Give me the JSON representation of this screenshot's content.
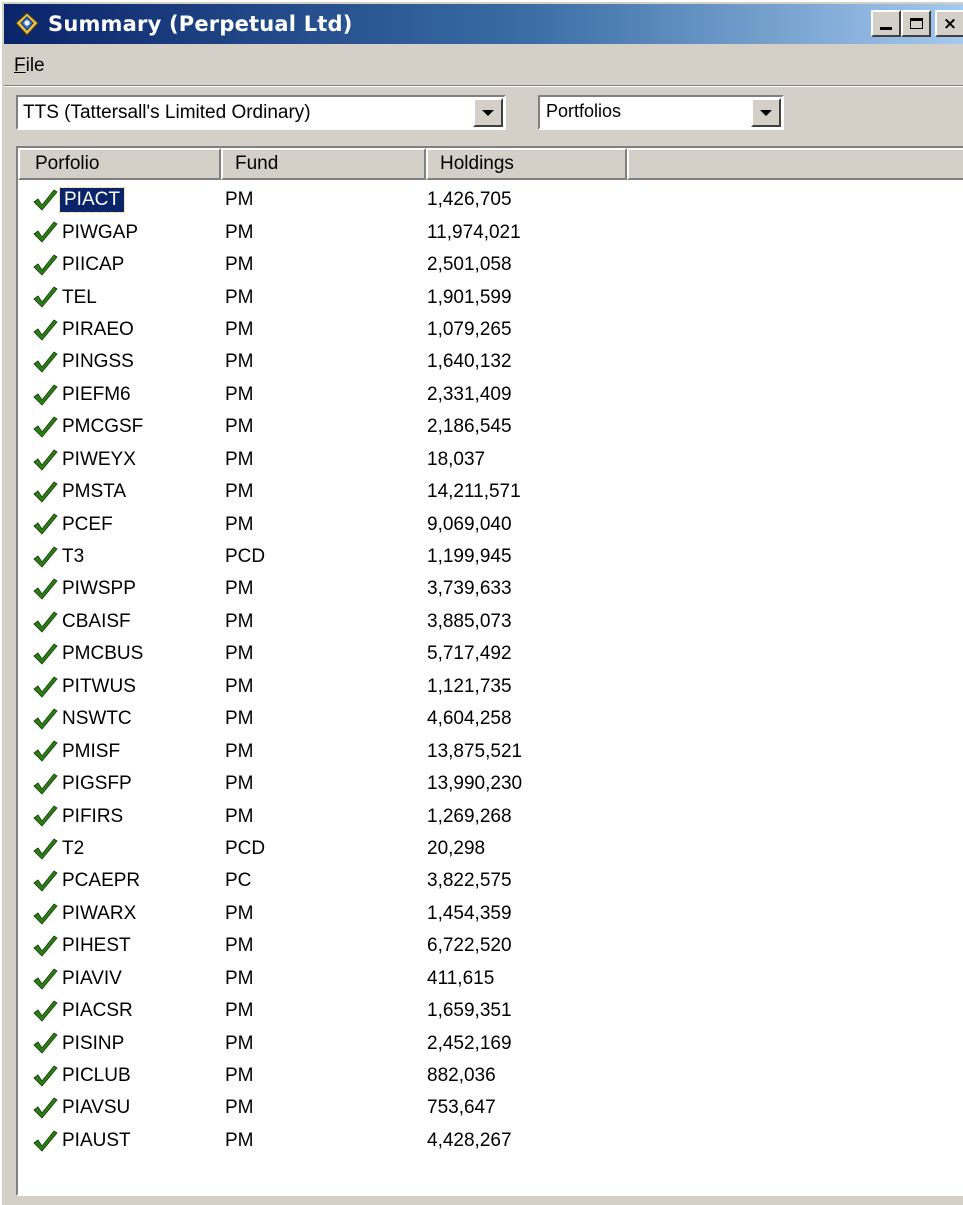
{
  "window": {
    "title": "Summary (Perpetual Ltd)",
    "buttons": {
      "minimize": "minimize-icon",
      "maximize": "maximize-icon",
      "close": "×"
    }
  },
  "menu": {
    "file_accel": "F",
    "file_rest": "ile"
  },
  "security_combo": {
    "value": "TTS (Tattersall's Limited Ordinary)"
  },
  "view_combo": {
    "value": "Portfolios"
  },
  "list": {
    "columns": [
      "Porfolio",
      "Fund",
      "Holdings"
    ],
    "selected_index": 0,
    "check_color": "#2e7d14",
    "rows": [
      {
        "portfolio": "PIACT",
        "fund": "PM",
        "holdings": "1,426,705"
      },
      {
        "portfolio": "PIWGAP",
        "fund": "PM",
        "holdings": "11,974,021"
      },
      {
        "portfolio": "PIICAP",
        "fund": "PM",
        "holdings": "2,501,058"
      },
      {
        "portfolio": "TEL",
        "fund": "PM",
        "holdings": "1,901,599"
      },
      {
        "portfolio": "PIRAEO",
        "fund": "PM",
        "holdings": "1,079,265"
      },
      {
        "portfolio": "PINGSS",
        "fund": "PM",
        "holdings": "1,640,132"
      },
      {
        "portfolio": "PIEFM6",
        "fund": "PM",
        "holdings": "2,331,409"
      },
      {
        "portfolio": "PMCGSF",
        "fund": "PM",
        "holdings": "2,186,545"
      },
      {
        "portfolio": "PIWEYX",
        "fund": "PM",
        "holdings": "18,037"
      },
      {
        "portfolio": "PMSTA",
        "fund": "PM",
        "holdings": "14,211,571"
      },
      {
        "portfolio": "PCEF",
        "fund": "PM",
        "holdings": "9,069,040"
      },
      {
        "portfolio": "T3",
        "fund": "PCD",
        "holdings": "1,199,945"
      },
      {
        "portfolio": "PIWSPP",
        "fund": "PM",
        "holdings": "3,739,633"
      },
      {
        "portfolio": "CBAISF",
        "fund": "PM",
        "holdings": "3,885,073"
      },
      {
        "portfolio": "PMCBUS",
        "fund": "PM",
        "holdings": "5,717,492"
      },
      {
        "portfolio": "PITWUS",
        "fund": "PM",
        "holdings": "1,121,735"
      },
      {
        "portfolio": "NSWTC",
        "fund": "PM",
        "holdings": "4,604,258"
      },
      {
        "portfolio": "PMISF",
        "fund": "PM",
        "holdings": "13,875,521"
      },
      {
        "portfolio": "PIGSFP",
        "fund": "PM",
        "holdings": "13,990,230"
      },
      {
        "portfolio": "PIFIRS",
        "fund": "PM",
        "holdings": "1,269,268"
      },
      {
        "portfolio": "T2",
        "fund": "PCD",
        "holdings": "20,298"
      },
      {
        "portfolio": "PCAEPR",
        "fund": "PC",
        "holdings": "3,822,575"
      },
      {
        "portfolio": "PIWARX",
        "fund": "PM",
        "holdings": "1,454,359"
      },
      {
        "portfolio": "PIHEST",
        "fund": "PM",
        "holdings": "6,722,520"
      },
      {
        "portfolio": "PIAVIV",
        "fund": "PM",
        "holdings": "411,615"
      },
      {
        "portfolio": "PIACSR",
        "fund": "PM",
        "holdings": "1,659,351"
      },
      {
        "portfolio": "PISINP",
        "fund": "PM",
        "holdings": "2,452,169"
      },
      {
        "portfolio": "PICLUB",
        "fund": "PM",
        "holdings": "882,036"
      },
      {
        "portfolio": "PIAVSU",
        "fund": "PM",
        "holdings": "753,647"
      },
      {
        "portfolio": "PIAUST",
        "fund": "PM",
        "holdings": "4,428,267"
      }
    ]
  }
}
